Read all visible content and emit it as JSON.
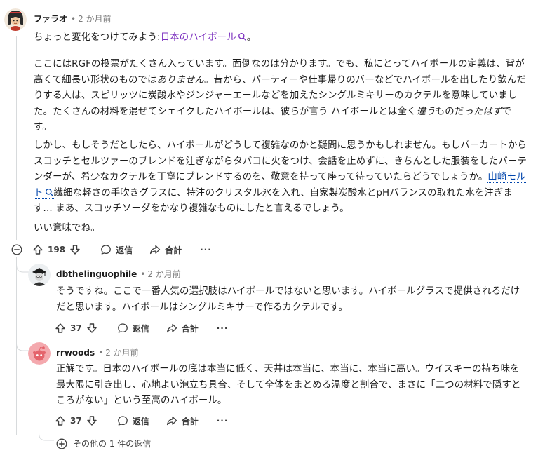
{
  "comment": {
    "author": "ファラオ",
    "time": "2 か月前",
    "line1_before": "ちょっと変化をつけてみよう:",
    "line1_link": "日本のハイボール",
    "line1_after": "。",
    "p2_a": "ここにはRGFの投票がたくさん入っています。面倒なのは分かります。でも、私にとってハイボールの定義は、背が高くて細長い形状のものでは",
    "p2_em1": "ありません",
    "p2_b": "。昔から、パーティーや仕事帰りのバーなどでハイボールを出したり飲んだりする人は、スピリッツに炭酸水やジンジャーエールなどを加えたシングルミキサーのカクテルを意味していました。たくさんの材料を混ぜてシェイクしたハイボールは、彼らが言う ハイボールとは全く",
    "p2_em2": "違う",
    "p2_c": "ものだ",
    "p2_em3": "ったはず",
    "p2_d": "です。",
    "p3_a": "しかし、もしそうだとしたら、ハイボールがどうして複雑なのかと疑問に思うかもしれません。もしバーカートからスコッチとセルツァーのブレンドを注ぎながらタバコに火をつけ、会話を止めずに、きちんとした服装をしたバーテンダーが、希少なカクテルを丁寧にブレンドするのを、敬意を持って座って待っていたらどうでしょうか。",
    "p3_link": "山崎モルト",
    "p3_b": "繊細な軽さの手吹きグラスに、特注のクリスタル氷を入れ、自家製炭酸水とpHバランスの取れた水を注ぎます... まあ、スコッチソーダをかなり複雑なものにしたと言えるでしょう。",
    "p4": "いい意味でね。",
    "votes": "198",
    "reply_label": "返信",
    "share_label": "合計",
    "more": "···"
  },
  "replies": [
    {
      "author": "dbthelinguophile",
      "time": "2 か月前",
      "text": "そうですね。ここで一番人気の選択肢はハイボールではないと思います。ハイボールグラスで提供されるだけだと思います。ハイボールはシングルミキサーで作るカクテルです。",
      "votes": "37",
      "reply_label": "返信",
      "share_label": "合計",
      "more": "···"
    },
    {
      "author": "rrwoods",
      "time": "2 か月前",
      "text": "正解です。日本のハイボールの底は本当に低く、天井は本当に、本当に、本当に高い。ウイスキーの持ち味を最大限に引き出し、心地よい泡立ち具合、そして全体をまとめる温度と割合で、まさに「二つの材料で隠すところがない」という至高のハイボール。",
      "votes": "37",
      "reply_label": "返信",
      "share_label": "合計",
      "more": "···"
    }
  ],
  "more_replies": "その他の 1 件の返信",
  "colors": {
    "link_purple": "#7b2fbf",
    "link_blue": "#0045ac",
    "thread": "#d7dadc",
    "meta_gray": "#7c7c7c"
  },
  "icons": [
    "avatar-pharaoh",
    "search-icon",
    "upvote-icon",
    "downvote-icon",
    "comment-icon",
    "share-icon",
    "collapse-icon",
    "plus-circle-icon",
    "snoo-avatar"
  ]
}
